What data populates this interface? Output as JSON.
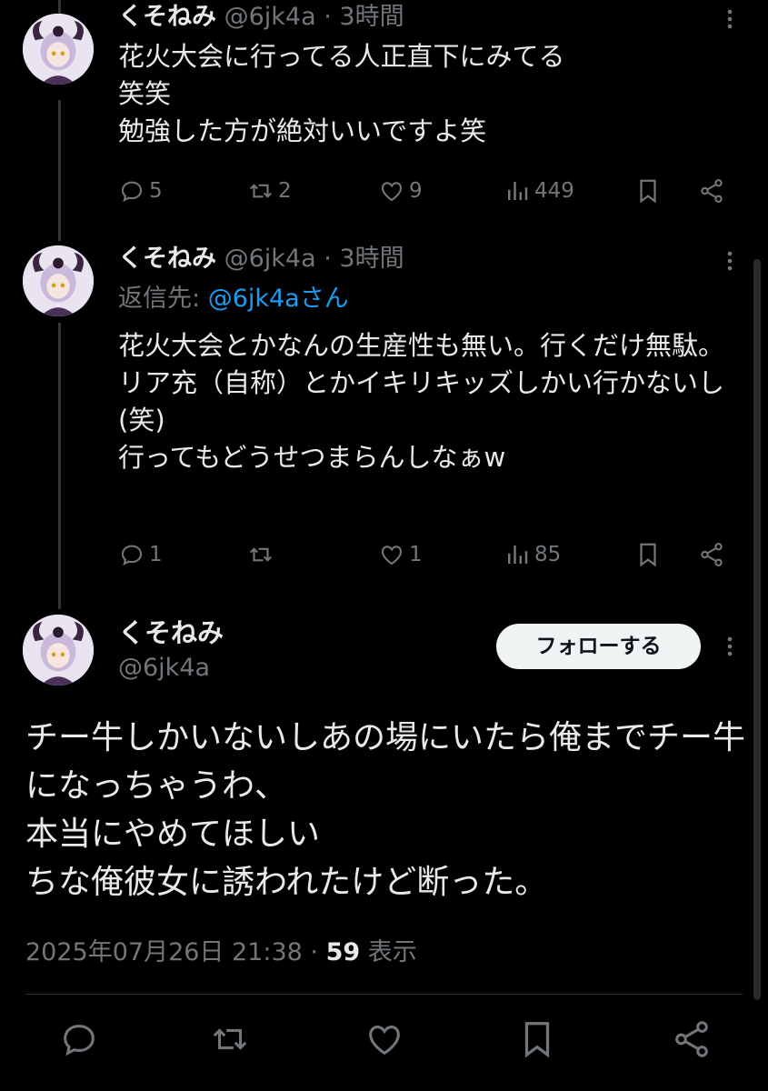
{
  "tweets": [
    {
      "name": "くそねみ",
      "handle": "@6jk4a",
      "time": "3時間",
      "text": "花火大会に行ってる人正直下にみてる\n笑笑\n勉強した方が絶対いいですよ笑",
      "replies": "5",
      "retweets": "2",
      "likes": "9",
      "views": "449"
    },
    {
      "name": "くそねみ",
      "handle": "@6jk4a",
      "time": "3時間",
      "replying_label": "返信先: ",
      "replying_handle": "@6jk4aさん",
      "text": "花火大会とかなんの生産性も無い。行くだけ無駄。\nリア充（自称）とかイキリキッズしかい行かないし(笑)\n行ってもどうせつまらんしなぁw",
      "replies": "1",
      "retweets": "",
      "likes": "1",
      "views": "85"
    }
  ],
  "main": {
    "name": "くそねみ",
    "handle": "@6jk4a",
    "follow_label": "フォローする",
    "text": "チー牛しかいないしあの場にいたら俺までチー牛になっちゃうわ、\n本当にやめてほしい\nちな俺彼女に誘われたけど断った。",
    "date": "2025年07月26日 21:38 · ",
    "views_count": "59",
    "views_label": " 表示"
  },
  "separator": " · ",
  "icons": [
    "reply-icon",
    "retweet-icon",
    "like-icon",
    "views-icon",
    "bookmark-icon",
    "share-icon",
    "more-icon"
  ],
  "colors": {
    "background": "#000000",
    "text": "#e7e9ea",
    "muted": "#71767b",
    "link": "#1d9bf0",
    "button": "#eff3f4"
  }
}
